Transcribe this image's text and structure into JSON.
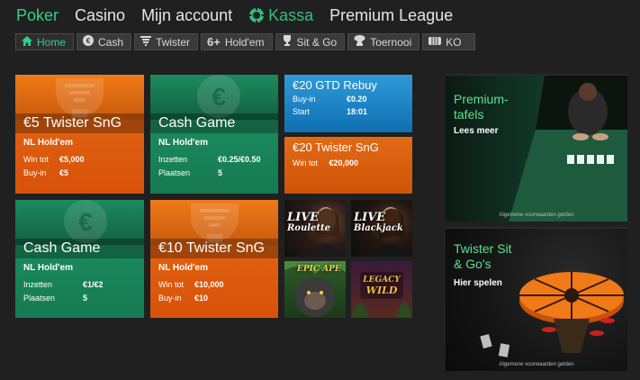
{
  "topnav": {
    "items": [
      {
        "label": "Poker"
      },
      {
        "label": "Casino"
      },
      {
        "label": "Mijn account"
      },
      {
        "label": "Kassa"
      },
      {
        "label": "Premium League"
      }
    ],
    "active_color": "#2fd08a"
  },
  "subnav": {
    "tabs": [
      {
        "label": "Home",
        "icon": "home-icon"
      },
      {
        "label": "Cash",
        "icon": "euro-icon"
      },
      {
        "label": "Twister",
        "icon": "twister-icon"
      },
      {
        "label": "Hold'em",
        "icon": "six-plus-icon",
        "prefix": "6+"
      },
      {
        "label": "Sit & Go",
        "icon": "trophy-icon"
      },
      {
        "label": "Toernooi",
        "icon": "trophy-cup-icon"
      },
      {
        "label": "KO",
        "icon": "ko-icon"
      }
    ]
  },
  "tiles": {
    "twister5": {
      "title": "€5 Twister SnG",
      "sub": "NL Hold'em",
      "r1k": "Win tot",
      "r1v": "€5,000",
      "r2k": "Buy-in",
      "r2v": "€5"
    },
    "cash1": {
      "title": "Cash Game",
      "sub": "NL Hold'em",
      "r1k": "Inzetten",
      "r1v": "€0.25/€0.50",
      "r2k": "Plaatsen",
      "r2v": "5"
    },
    "cash2": {
      "title": "Cash Game",
      "sub": "NL Hold'em",
      "r1k": "Inzetten",
      "r1v": "€1/€2",
      "r2k": "Plaatsen",
      "r2v": "5"
    },
    "twister10": {
      "title": "€10 Twister SnG",
      "sub": "NL Hold'em",
      "r1k": "Win tot",
      "r1v": "€10,000",
      "r2k": "Buy-in",
      "r2v": "€10"
    }
  },
  "promos": {
    "rebuy": {
      "title": "€20 GTD Rebuy",
      "r1k": "Buy-in",
      "r1v": "€0.20",
      "r2k": "Start",
      "r2v": "18:01"
    },
    "twister20": {
      "title": "€20 Twister SnG",
      "rk": "Win tot",
      "rv": "€20,000"
    }
  },
  "games": {
    "roulette": {
      "l1": "LIVE",
      "l2": "Roulette"
    },
    "blackjack": {
      "l1": "LIVE",
      "l2": "Blackjack"
    },
    "epic": {
      "l1": "EPIC APE"
    },
    "legacy": {
      "l1": "LEGACY",
      "l2": "WILD"
    }
  },
  "side": {
    "premium": {
      "h1": "Premium-",
      "h2": "tafels",
      "link": "Lees meer",
      "legal": "Algemene voorwaarden gelden"
    },
    "twister": {
      "h1": "Twister Sit",
      "h2": "& Go's",
      "link": "Hier spelen",
      "legal": "Algemene voorwaarden gelden"
    }
  }
}
